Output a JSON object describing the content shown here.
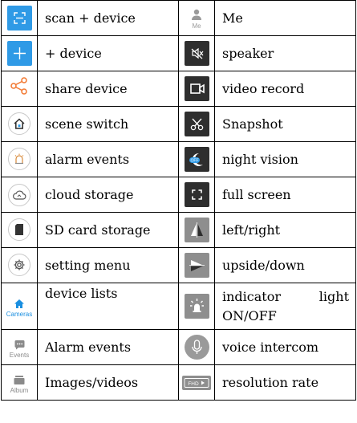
{
  "colors": {
    "blue": "#2f9ae6",
    "orange": "#f2762e",
    "dark": "#2e2e2e",
    "grey": "#8e8e8e",
    "tab_blue": "#1b8fe0"
  },
  "rows": [
    {
      "left_icon": "scan-icon",
      "left": "scan + device",
      "right_icon": "person-icon",
      "right_icon_label": "Me",
      "right": "Me"
    },
    {
      "left_icon": "plus-icon",
      "left": "+ device",
      "right_icon": "speaker-mute-icon",
      "right": "speaker"
    },
    {
      "left_icon": "share-icon",
      "left": "share device",
      "right_icon": "video-camera-icon",
      "right": "video record"
    },
    {
      "left_icon": "house-icon",
      "left": "scene switch",
      "right_icon": "scissors-icon",
      "right": "Snapshot"
    },
    {
      "left_icon": "alarm-icon",
      "left": "alarm events",
      "right_icon": "night-vision-icon",
      "right_icon_label": "OFF",
      "right": "night vision"
    },
    {
      "left_icon": "cloud-icon",
      "left": "cloud storage",
      "right_icon": "fullscreen-icon",
      "right": "full screen"
    },
    {
      "left_icon": "sd-card-icon",
      "left": "SD card storage",
      "right_icon": "flip-horizontal-icon",
      "right": "left/right"
    },
    {
      "left_icon": "gear-icon",
      "left": "setting menu",
      "right_icon": "flip-vertical-icon",
      "right": "upside/down"
    },
    {
      "left_icon": "home-tab-icon",
      "left_icon_label": "Cameras",
      "left": "device lists",
      "right_icon": "indicator-light-icon",
      "right_line1_a": "indicator",
      "right_line1_b": "light",
      "right_line2": "ON/OFF"
    },
    {
      "left_icon": "chat-tab-icon",
      "left_icon_label": "Events",
      "left": "Alarm events",
      "right_icon": "microphone-icon",
      "right": "voice intercom"
    },
    {
      "left_icon": "album-tab-icon",
      "left_icon_label": "Album",
      "left": "Images/videos",
      "right_icon": "fhd-icon",
      "right_icon_label": "FHD",
      "right": "resolution rate"
    }
  ]
}
